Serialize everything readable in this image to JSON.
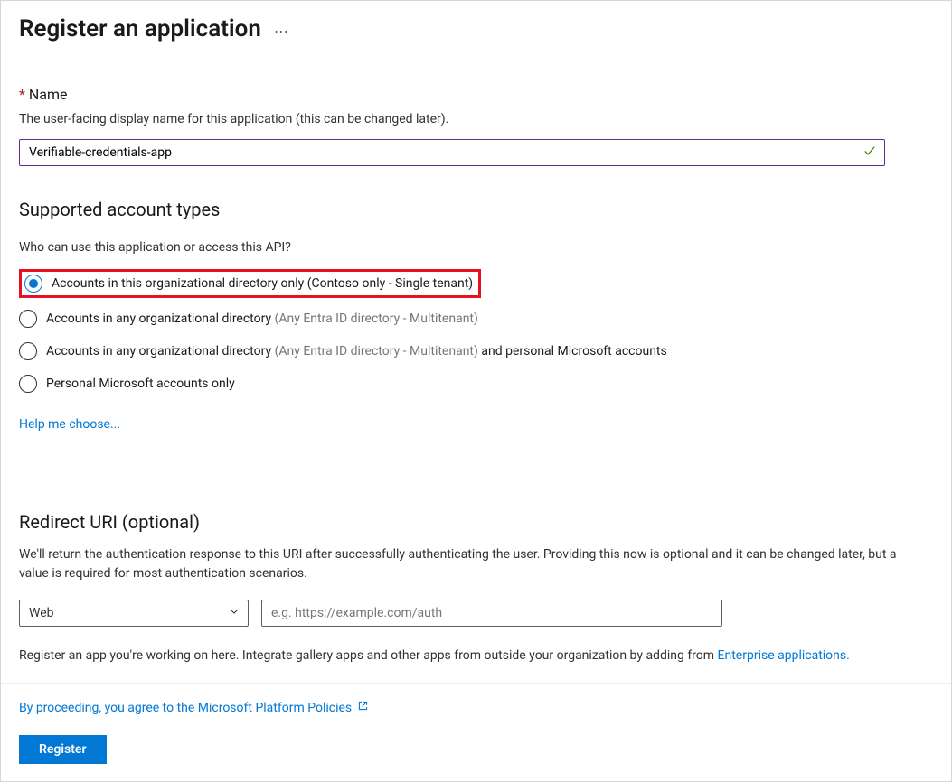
{
  "header": {
    "title": "Register an application"
  },
  "name_field": {
    "label": "Name",
    "hint": "The user-facing display name for this application (this can be changed later).",
    "value": "Verifiable-credentials-app"
  },
  "account_types": {
    "heading": "Supported account types",
    "question": "Who can use this application or access this API?",
    "options": [
      {
        "label": "Accounts in this organizational directory only (Contoso only - Single tenant)",
        "selected": true,
        "highlighted": true
      },
      {
        "label_main": "Accounts in any organizational directory ",
        "label_muted": "(Any Entra ID directory - Multitenant)",
        "label_after": "",
        "selected": false
      },
      {
        "label_main": "Accounts in any organizational directory ",
        "label_muted": "(Any Entra ID directory - Multitenant)",
        "label_after": "  and personal Microsoft accounts",
        "selected": false
      },
      {
        "label": "Personal Microsoft accounts only",
        "selected": false
      }
    ],
    "help_link": "Help me choose..."
  },
  "redirect": {
    "heading": "Redirect URI (optional)",
    "description": "We'll return the authentication response to this URI after successfully authenticating the user. Providing this now is optional and it can be changed later, but a value is required for most authentication scenarios.",
    "platform_value": "Web",
    "uri_placeholder": "e.g. https://example.com/auth",
    "note_before": "Register an app you're working on here. Integrate gallery apps and other apps from outside your organization by adding from ",
    "note_link": "Enterprise applications."
  },
  "footer": {
    "policy_text": "By proceeding, you agree to the Microsoft Platform Policies",
    "register_button": "Register"
  }
}
